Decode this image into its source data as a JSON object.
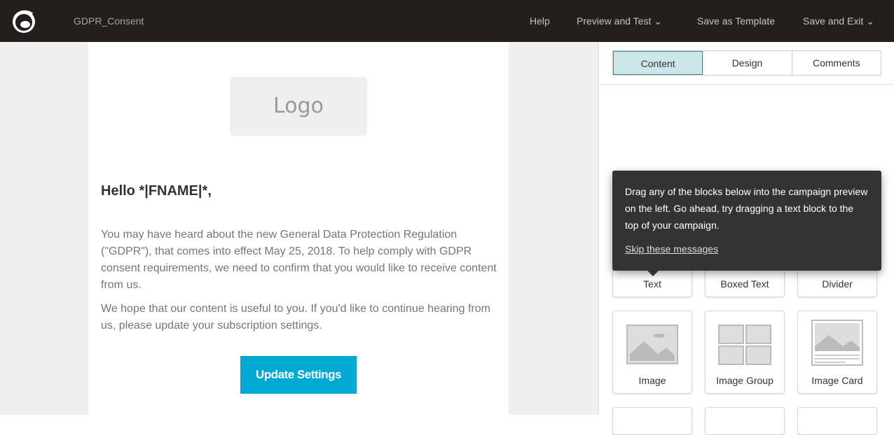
{
  "header": {
    "title": "GDPR_Consent",
    "help": "Help",
    "preview": "Preview and Test",
    "save_template": "Save as Template",
    "save_exit": "Save and Exit"
  },
  "email": {
    "logo": "Logo",
    "greeting": "Hello *|FNAME|*,",
    "paragraph1": "You may have heard about the new General Data Protection Regulation (\"GDPR\"), that comes into effect May 25, 2018. To help comply with GDPR consent requirements, we need to confirm that you would like to receive content from us.",
    "paragraph2": "We hope that our content is useful to you. If you'd like to continue hearing from us, please update your subscription settings.",
    "button": "Update Settings",
    "button_color": "#00a9d1"
  },
  "panel": {
    "tabs": [
      {
        "label": "Content",
        "selected": true
      },
      {
        "label": "Design"
      },
      {
        "label": "Comments"
      }
    ],
    "tooltip": {
      "text": "Drag any of the blocks below into the campaign preview on the left. Go ahead, try dragging a text block to the top of your campaign.",
      "skip": "Skip these messages"
    },
    "blocks": [
      "Text",
      "Boxed Text",
      "Divider",
      "Image",
      "Image Group",
      "Image Card"
    ]
  }
}
